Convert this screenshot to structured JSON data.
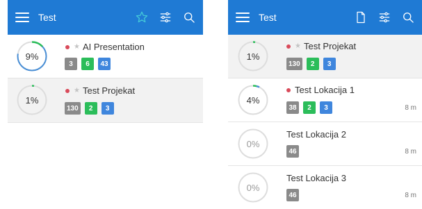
{
  "left": {
    "title": "Test",
    "rows": [
      {
        "percent": "9%",
        "progress": 0.09,
        "name": "AI Presentation",
        "badges": [
          "3",
          "6",
          "43"
        ]
      },
      {
        "percent": "1%",
        "progress": 0.01,
        "name": "Test Projekat",
        "badges": [
          "130",
          "2",
          "3"
        ]
      }
    ]
  },
  "right": {
    "title": "Test",
    "rows": [
      {
        "percent": "1%",
        "progress": 0.01,
        "name": "Test Projekat",
        "badges": [
          "130",
          "2",
          "3"
        ],
        "time": ""
      },
      {
        "percent": "4%",
        "progress": 0.04,
        "name": "Test Lokacija 1",
        "badges": [
          "38",
          "2",
          "3"
        ],
        "time": "8 m"
      },
      {
        "percent": "0%",
        "progress": 0,
        "name": "Test Lokacija 2",
        "badges": [
          "46"
        ],
        "time": "8 m"
      },
      {
        "percent": "0%",
        "progress": 0,
        "name": "Test Lokacija 3",
        "badges": [
          "46"
        ],
        "time": "8 m"
      }
    ]
  },
  "colors": {
    "appbar": "#1f7ad4",
    "favorite_icon": "#43c8d8",
    "dot": "#d94a5a",
    "badge_grey": "#8a8a8a",
    "badge_green": "#2bbd5a",
    "badge_blue": "#3f86dd",
    "ring_track": "#dddddd",
    "ring_progress_left": "#4a8fd6",
    "ring_progress_right": "#2bbd5a"
  },
  "icons": {
    "menu": "hamburger-icon",
    "favorite": "star-outline-icon",
    "filter": "sliders-icon",
    "search": "search-icon",
    "document": "document-icon"
  }
}
